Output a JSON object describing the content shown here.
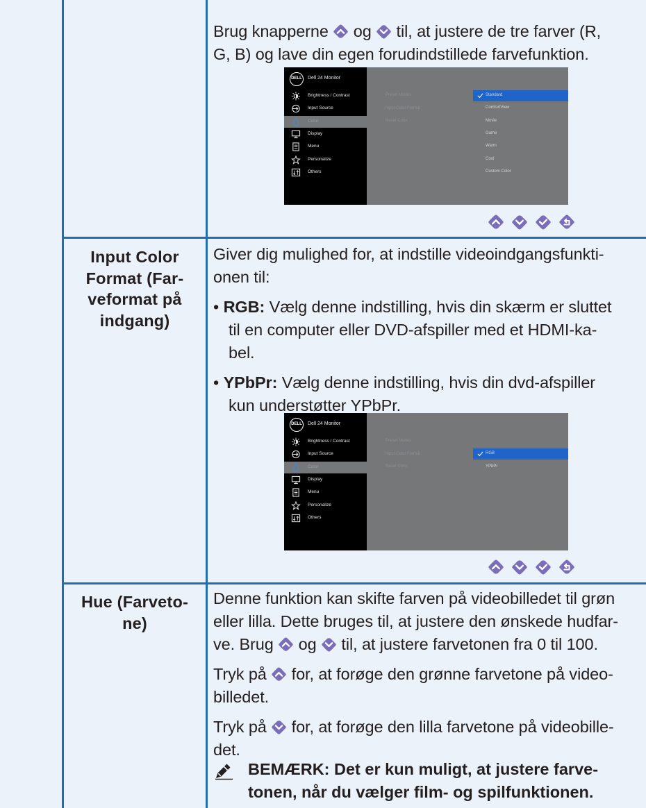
{
  "colors": {
    "accent": "#1f6eb2",
    "icon_fill": "#7b6eb8",
    "osd_selected": "#1f64c8"
  },
  "intro": {
    "line1a": "Brug knapperne",
    "line1b": "og",
    "line1c": "til, at justere de tre farver (R,",
    "line2": "G, B) og lave din egen forudindstillede farvefunktion."
  },
  "osd": {
    "title": "Dell 24 Monitor",
    "logo": "DELL",
    "menu": [
      {
        "label": "Brightness / Contrast",
        "icon": "brightness-icon"
      },
      {
        "label": "Input Source",
        "icon": "input-source-icon"
      },
      {
        "label": "Color",
        "icon": "color-icon"
      },
      {
        "label": "Display",
        "icon": "display-icon"
      },
      {
        "label": "Menu",
        "icon": "menu-icon"
      },
      {
        "label": "Personalize",
        "icon": "star-icon"
      },
      {
        "label": "Others",
        "icon": "others-icon"
      }
    ],
    "sub": [
      "Preset Modes",
      "Input Color Format",
      "Reset Color"
    ],
    "preset_options": [
      "Standard",
      "ComfortView",
      "Movie",
      "Game",
      "Warm",
      "Cool",
      "Custom Color"
    ],
    "format_options": [
      "RGB",
      "YPbPr"
    ]
  },
  "input_color_format": {
    "label_lines": [
      "Input Color",
      "Format (Far-",
      "veformat på",
      "indgang)"
    ],
    "desc1": "Giver dig mulighed for, at indstille videoindgangsfunkti-",
    "desc2": "onen til:",
    "rgb_term": "RGB:",
    "rgb_l1": "Vælg denne indstilling, hvis din skærm er sluttet",
    "rgb_l2": "til en computer eller DVD-afspiller med et HDMI-ka-",
    "rgb_l3": "bel.",
    "ypbpr_term": "YPbPr:",
    "ypbpr_l1": "Vælg denne indstilling, hvis din dvd-afspiller",
    "ypbpr_l2": "kun understøtter YPbPr."
  },
  "hue": {
    "label_lines": [
      "Hue (Farveto-",
      "ne)"
    ],
    "p1_l1": "Denne funktion kan skifte farven på videobilledet til grøn",
    "p1_l2": "eller lilla. Dette bruges til, at justere den ønskede hudfar-",
    "p1_l3a": "ve. Brug",
    "p1_l3b": "og",
    "p1_l3c": "til, at justere farvetonen fra 0 til 100.",
    "p2_a": "Tryk på",
    "p2_b": "for, at forøge den grønne farvetone på video-",
    "p2_l2": "billedet.",
    "p3_a": "Tryk på",
    "p3_b": "for, at forøge den lilla farvetone på videobille-",
    "p3_l2": "det.",
    "note_l1": "BEMÆRK: Det er kun muligt, at justere farve-",
    "note_l2": "tonen, når du vælger film- og spilfunktionen."
  }
}
